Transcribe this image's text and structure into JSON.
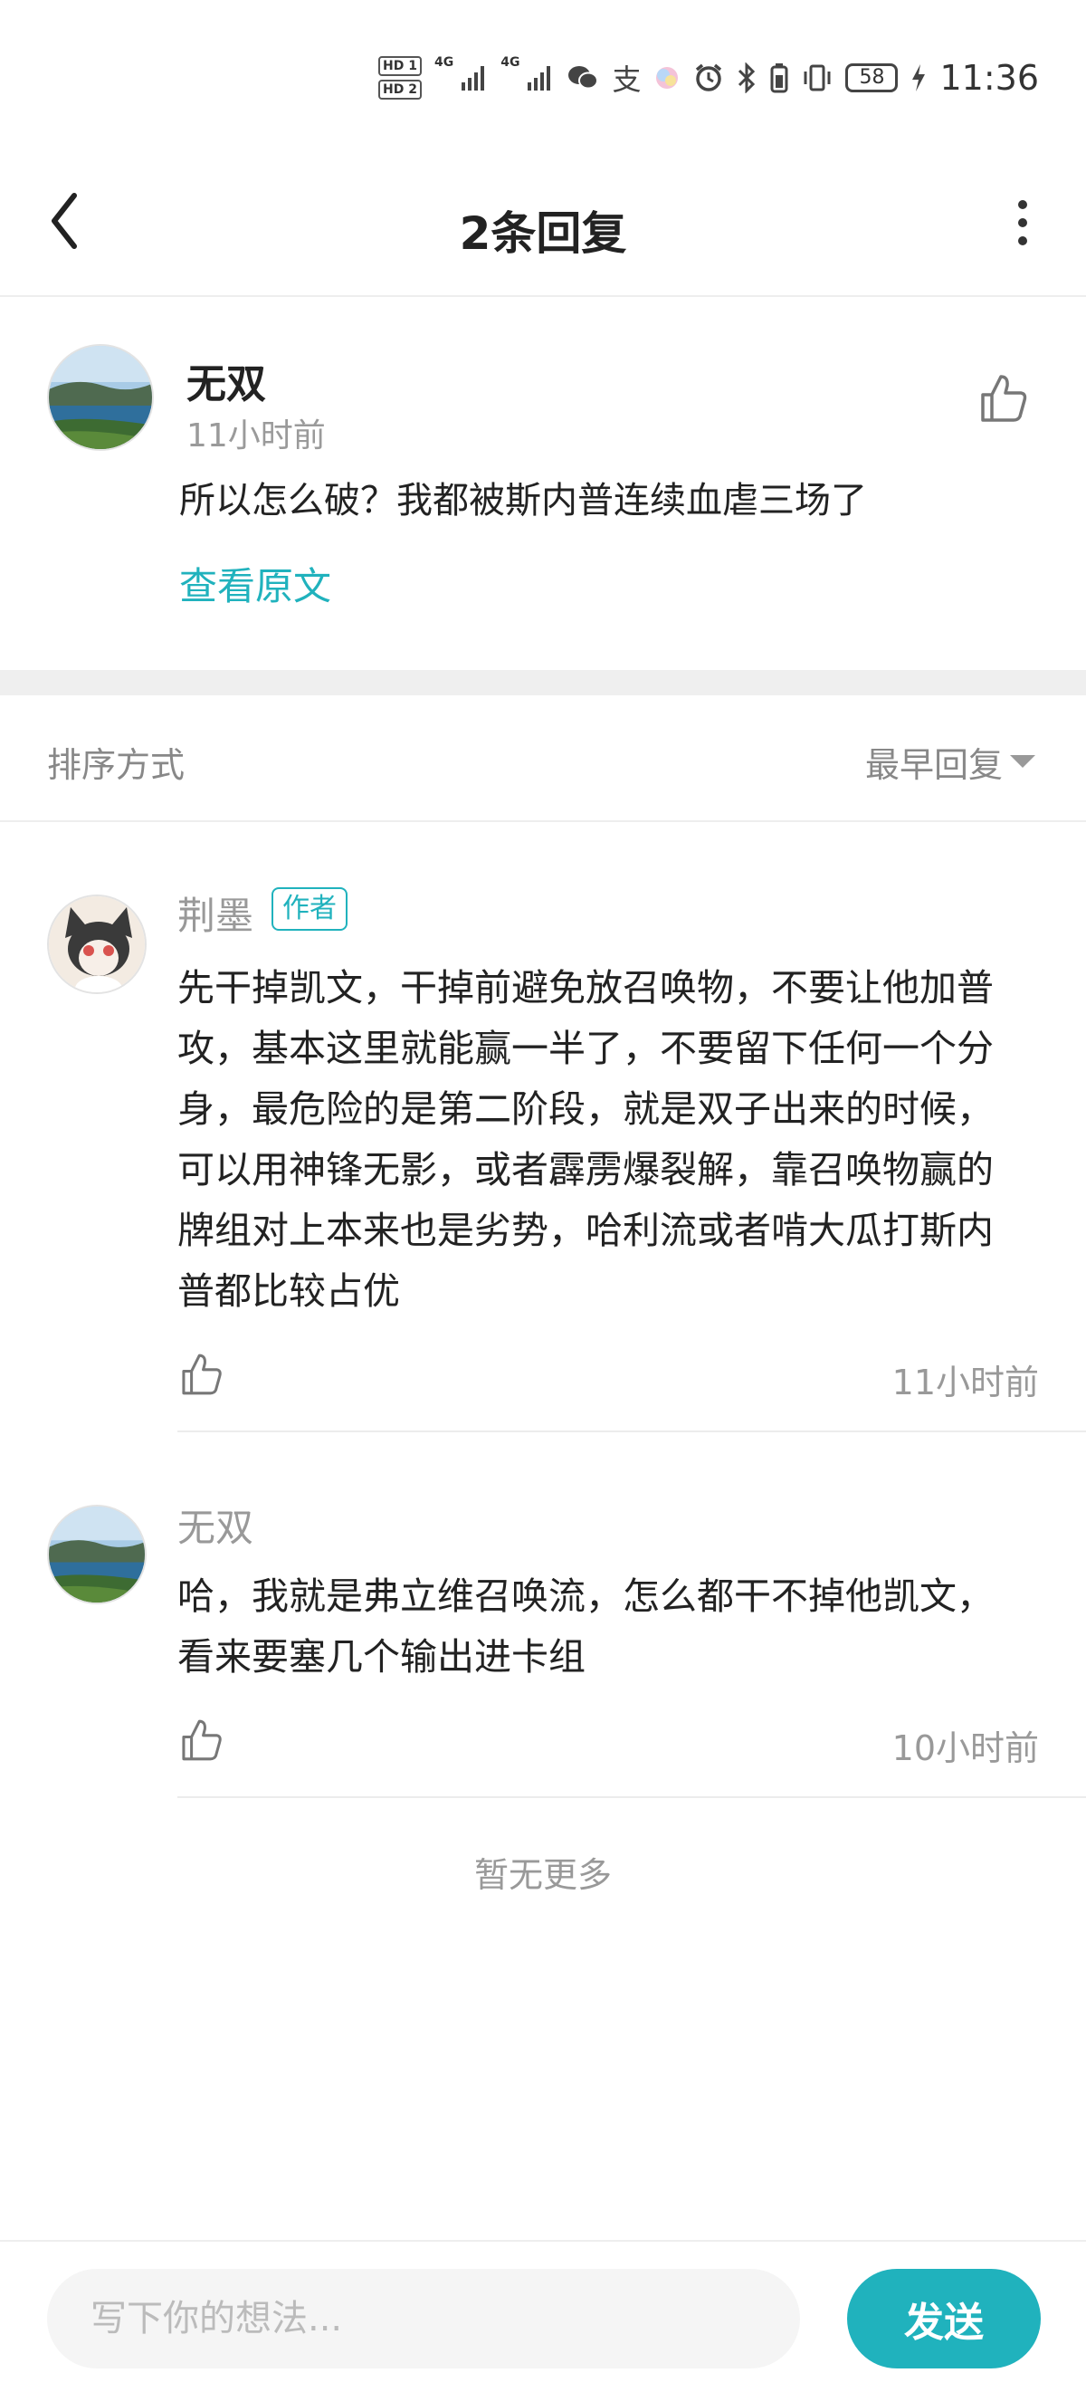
{
  "status_bar": {
    "hd1": "HD 1",
    "hd2": "HD 2",
    "net1": "4G",
    "net2": "4G",
    "alipay": "支",
    "battery": "58",
    "time": "11:36"
  },
  "header": {
    "title": "2条回复"
  },
  "original_post": {
    "author": "无双",
    "time": "11小时前",
    "text": "所以怎么破？我都被斯内普连续血虐三场了",
    "view_original": "查看原文"
  },
  "sort": {
    "label": "排序方式",
    "value": "最早回复"
  },
  "replies": [
    {
      "author": "荆墨",
      "badge": "作者",
      "text": "先干掉凯文，干掉前避免放召唤物，不要让他加普攻，基本这里就能赢一半了，不要留下任何一个分身，最危险的是第二阶段，就是双子出来的时候，可以用神锋无影，或者霹雳爆裂解，靠召唤物赢的牌组对上本来也是劣势，哈利流或者啃大瓜打斯内普都比较占优",
      "time": "11小时前"
    },
    {
      "author": "无双",
      "text": "哈，我就是弗立维召唤流，怎么都干不掉他凯文，看来要塞几个输出进卡组",
      "time": "10小时前"
    }
  ],
  "no_more": "暂无更多",
  "composer": {
    "placeholder": "写下你的想法...",
    "send_label": "发送"
  },
  "colors": {
    "accent": "#20b2bd",
    "muted_text": "#999999",
    "divider": "#efefef"
  }
}
